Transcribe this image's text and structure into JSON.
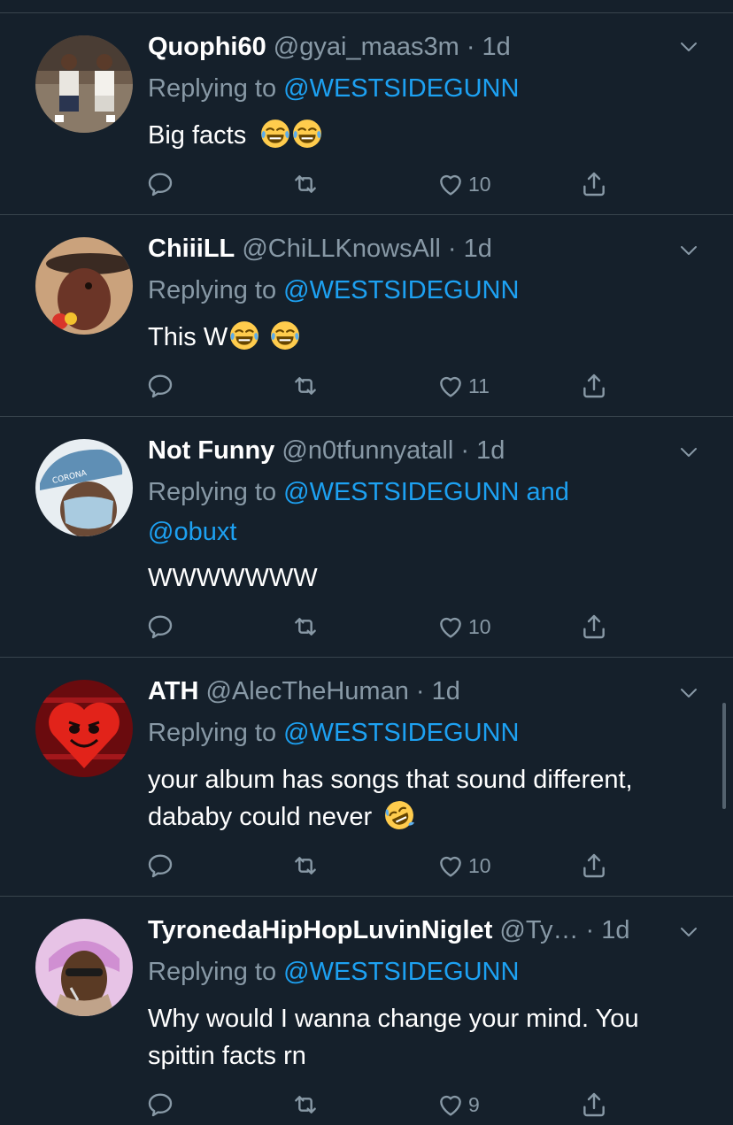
{
  "tweets": [
    {
      "name": "Quophi60",
      "handle": "@gyai_maas3m",
      "time": "· 1d",
      "replying_prefix": "Replying to",
      "replying_to": "@WESTSIDEGUNN",
      "body": "Big facts",
      "body_emoji": [
        "face-with-tears-of-joy",
        "face-with-tears-of-joy"
      ],
      "likes": "10",
      "avatar_colors": [
        "#5b4a3f",
        "#c9c1b5"
      ]
    },
    {
      "name": "ChiiiLL",
      "handle": "@ChiLLKnowsAll",
      "time": "· 1d",
      "replying_prefix": "Replying to",
      "replying_to": "@WESTSIDEGUNN",
      "body": "This W",
      "body_emoji": [
        "face-with-tears-of-joy",
        "face-with-tears-of-joy"
      ],
      "likes": "11",
      "avatar_colors": [
        "#c8a27a",
        "#6b3b2a"
      ]
    },
    {
      "name": "Not Funny",
      "handle": "@n0tfunnyatall",
      "time": "· 1d",
      "replying_prefix": "Replying to",
      "replying_to": "@WESTSIDEGUNN and",
      "replying_to_2": "@obuxt",
      "body": "WWWWWWW",
      "body_emoji": [],
      "likes": "10",
      "avatar_colors": [
        "#5f8fb5",
        "#dfe8ee"
      ],
      "avatar_text": "CORONA"
    },
    {
      "name": "ATH",
      "handle": "@AlecTheHuman",
      "time": "· 1d",
      "replying_prefix": "Replying to",
      "replying_to": "@WESTSIDEGUNN",
      "body_line1": "your album has songs that sound different,",
      "body_line2": "dababy could never",
      "body_emoji": [
        "rolling-on-the-floor-laughing"
      ],
      "likes": "10",
      "avatar_colors": [
        "#8b0f12",
        "#e2231a"
      ]
    },
    {
      "name": "TyronedaHipHopLuvinNiglet",
      "handle": "@Ty…",
      "time": "· 1d",
      "replying_prefix": "Replying to",
      "replying_to": "@WESTSIDEGUNN",
      "body_line1": "Why would I wanna change your mind. You",
      "body_line2": "spittin facts rn",
      "body_emoji": [],
      "likes": "9",
      "avatar_colors": [
        "#d9a3d9",
        "#6e4a2e"
      ]
    }
  ],
  "icons": {
    "reply": "reply-icon",
    "retweet": "retweet-icon",
    "like": "heart-icon",
    "share": "share-icon",
    "more": "chevron-down-icon"
  },
  "colors": {
    "background": "#15202b",
    "divider": "#38444d",
    "secondary_text": "#8899a6",
    "link": "#1da1f2"
  }
}
